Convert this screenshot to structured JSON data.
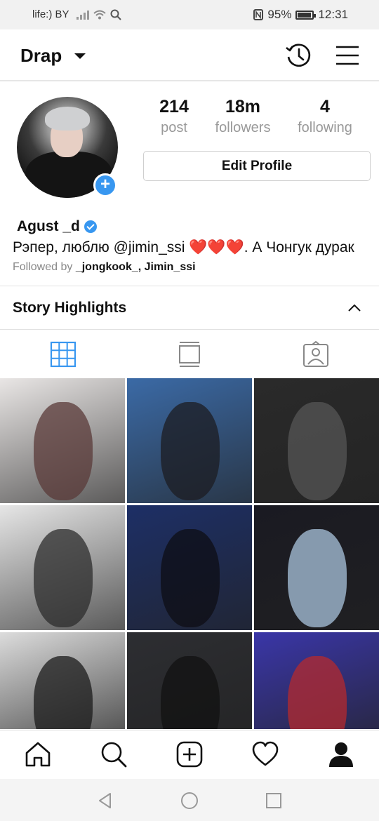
{
  "status_bar": {
    "carrier": "life:) BY",
    "battery": "95%",
    "battery_level": 0.95,
    "time": "12:31"
  },
  "header": {
    "username": "Drap",
    "icons": [
      "dropdown-caret-icon",
      "history-icon",
      "menu-icon"
    ]
  },
  "profile": {
    "stats": [
      {
        "value": "214",
        "label": "post"
      },
      {
        "value": "18m",
        "label": "followers"
      },
      {
        "value": "4",
        "label": "following"
      }
    ],
    "edit_button": "Edit Profile",
    "name": "Agust _d",
    "bio": "Рэпер, люблю @jimin_ssi ❤️❤️❤️. А Чонгук дурак",
    "followed_by_prefix": "Followed by ",
    "followed_by_names": "_jongkook_, Jimin_ssi"
  },
  "story_highlights": {
    "label": "Story Highlights"
  },
  "tabs": [
    "grid-icon",
    "feed-icon",
    "tagged-icon"
  ],
  "grid_posts": [
    {
      "bg": "#e9e6e5",
      "fg": "#5a3a38"
    },
    {
      "bg": "#3b6aa6",
      "fg": "#1c1c22"
    },
    {
      "bg": "#2a2a2a",
      "fg": "#555555"
    },
    {
      "bg": "#e6e6e6",
      "fg": "#2c2c2c"
    },
    {
      "bg": "#1d2f66",
      "fg": "#0e0e14"
    },
    {
      "bg": "#1a1a22",
      "fg": "#a9c4de"
    },
    {
      "bg": "#dcdcdc",
      "fg": "#1b1b1b"
    },
    {
      "bg": "#2d2e32",
      "fg": "#121212"
    },
    {
      "bg": "#3a36a8",
      "fg": "#b4292e"
    }
  ],
  "bottom_nav": [
    "home-icon",
    "search-icon",
    "new-post-icon",
    "activity-heart-icon",
    "profile-icon"
  ],
  "system_nav": [
    "back-icon",
    "home-circle-icon",
    "recents-icon"
  ],
  "colors": {
    "accent": "#3897f0",
    "muted_text": "#999999"
  }
}
